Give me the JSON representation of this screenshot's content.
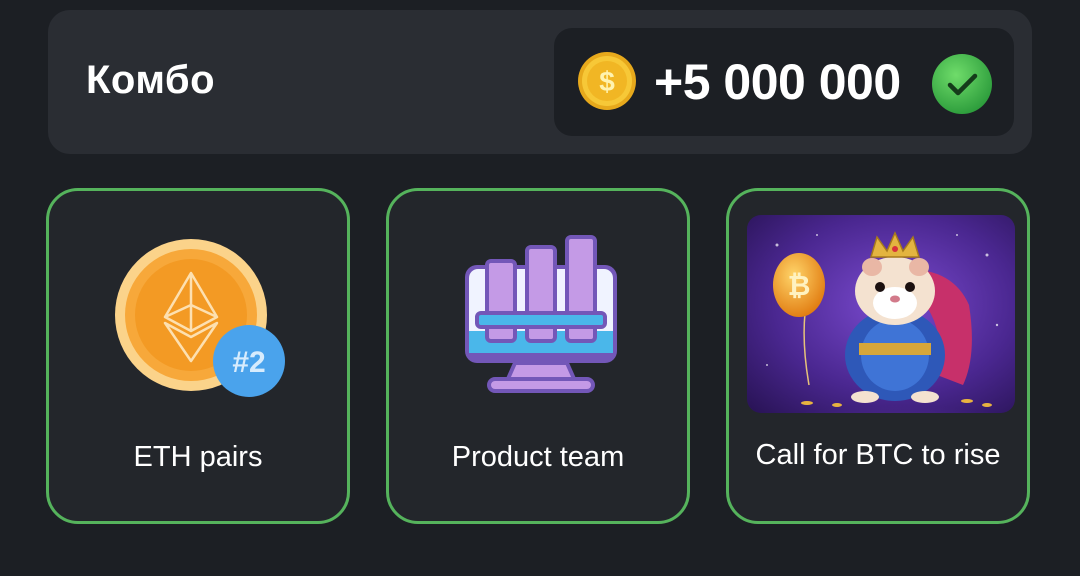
{
  "combo": {
    "title": "Комбо",
    "reward": "+5 000 000",
    "completed": true
  },
  "cards": [
    {
      "label": "ETH pairs",
      "icon": "eth-coin-icon",
      "badge": "#2"
    },
    {
      "label": "Product team",
      "icon": "bar-chart-monitor-icon"
    },
    {
      "label": "Call for BTC to rise",
      "icon": "hamster-king-image"
    }
  ],
  "colors": {
    "background": "#1c1f24",
    "card": "#23262b",
    "card_border": "#55b35c",
    "check": "#3fb34f",
    "coin": "#f5c030"
  }
}
